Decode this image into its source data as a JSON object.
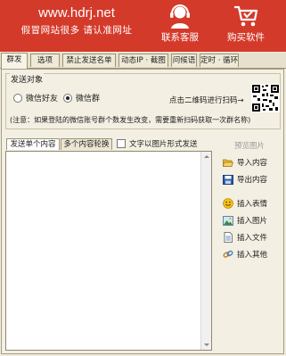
{
  "header": {
    "site_url": "www.hdrj.net",
    "slogan": "假冒网站很多 请认准网址",
    "service_label": "联系客服",
    "buy_label": "购买软件"
  },
  "tabs": [
    {
      "label": "群发"
    },
    {
      "label": "选项"
    },
    {
      "label": "禁止发送名单"
    },
    {
      "label": "动态IP · 截图"
    },
    {
      "label": "问候语"
    },
    {
      "label": "定时 · 循环"
    }
  ],
  "send_target": {
    "title": "发送对象",
    "options": [
      {
        "label": "微信好友",
        "selected": false
      },
      {
        "label": "微信群",
        "selected": true
      }
    ],
    "scan_hint": "点击二维码进行扫码→",
    "notice": "(注意：如果登陆的微信账号群个数发生改变，需要重新扫码获取一次群名称)"
  },
  "content": {
    "subtabs": [
      {
        "label": "发送单个内容"
      },
      {
        "label": "多个内容轮换"
      }
    ],
    "image_mode_label": "文字以图片形式发送",
    "image_mode_checked": false,
    "text": ""
  },
  "side": {
    "preview_label": "预览图片",
    "buttons": [
      {
        "label": "导入内容",
        "icon": "folder-open-icon"
      },
      {
        "label": "导出内容",
        "icon": "floppy-disk-icon"
      },
      {
        "label": "插入表情",
        "icon": "smiley-icon"
      },
      {
        "label": "插入图片",
        "icon": "picture-icon"
      },
      {
        "label": "插入文件",
        "icon": "document-icon"
      },
      {
        "label": "插入其他",
        "icon": "link-icon"
      }
    ]
  },
  "colors": {
    "header_red": "#d43a2a",
    "panel_bg": "#f3efe2"
  }
}
